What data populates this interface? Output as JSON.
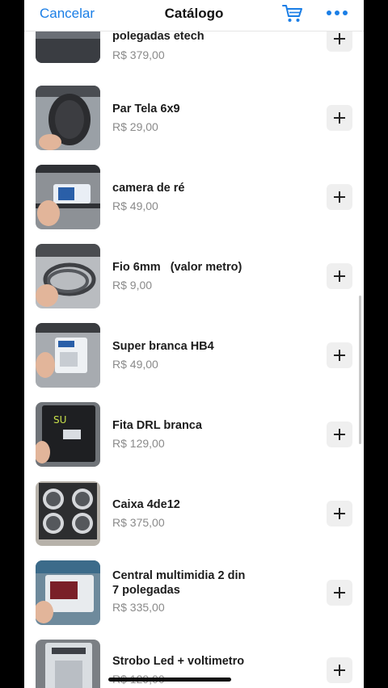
{
  "navbar": {
    "cancel_label": "Cancelar",
    "title": "Catálogo",
    "cart_icon": "cart-icon",
    "more_icon": "more-icon"
  },
  "colors": {
    "accent": "#1a7ee6",
    "price": "#8a8a8a",
    "add_bg": "#efefef"
  },
  "items": [
    {
      "name": "polegadas etech",
      "price": "R$ 379,00"
    },
    {
      "name": "Par Tela 6x9",
      "price": "R$ 29,00"
    },
    {
      "name": "camera de ré",
      "price": "R$ 49,00"
    },
    {
      "name": "Fio 6mm   (valor metro)",
      "price": "R$ 9,00"
    },
    {
      "name": "Super branca HB4",
      "price": "R$ 49,00"
    },
    {
      "name": "Fita DRL branca",
      "price": "R$ 129,00"
    },
    {
      "name": "Caixa 4de12",
      "price": "R$ 375,00"
    },
    {
      "name": "Central multimidia 2 din\n7 polegadas",
      "price": "R$ 335,00"
    },
    {
      "name": "Strobo Led + voltimetro",
      "price": "R$ 129,00"
    }
  ]
}
